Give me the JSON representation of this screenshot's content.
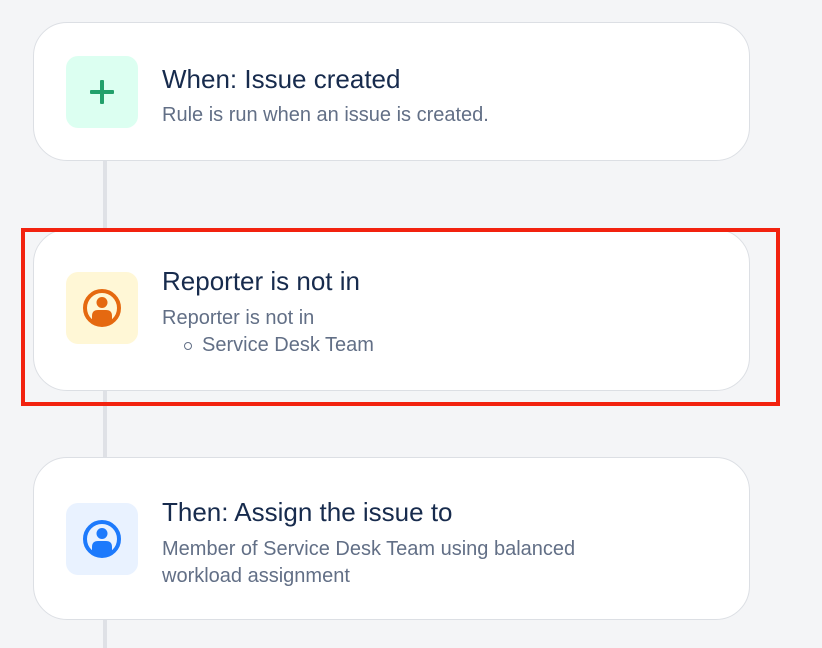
{
  "colors": {
    "background": "#f4f5f7",
    "highlight": "#f2220f",
    "trigger_icon_bg": "#dcfff1",
    "trigger_icon": "#22a06b",
    "condition_icon_bg": "#fff7d6",
    "condition_icon": "#e56910",
    "action_icon_bg": "#e9f2ff",
    "action_icon": "#1d7afc"
  },
  "rule": {
    "trigger": {
      "icon": "plus-icon",
      "title": "When: Issue created",
      "description": "Rule is run when an issue is created."
    },
    "condition": {
      "icon": "user-icon",
      "title": "Reporter is not in",
      "description": "Reporter is not in",
      "items": [
        "Service Desk Team"
      ]
    },
    "action": {
      "icon": "user-icon",
      "title": "Then: Assign the issue to",
      "description_line1": "Member of Service Desk Team using balanced",
      "description_line2": "workload assignment"
    }
  }
}
